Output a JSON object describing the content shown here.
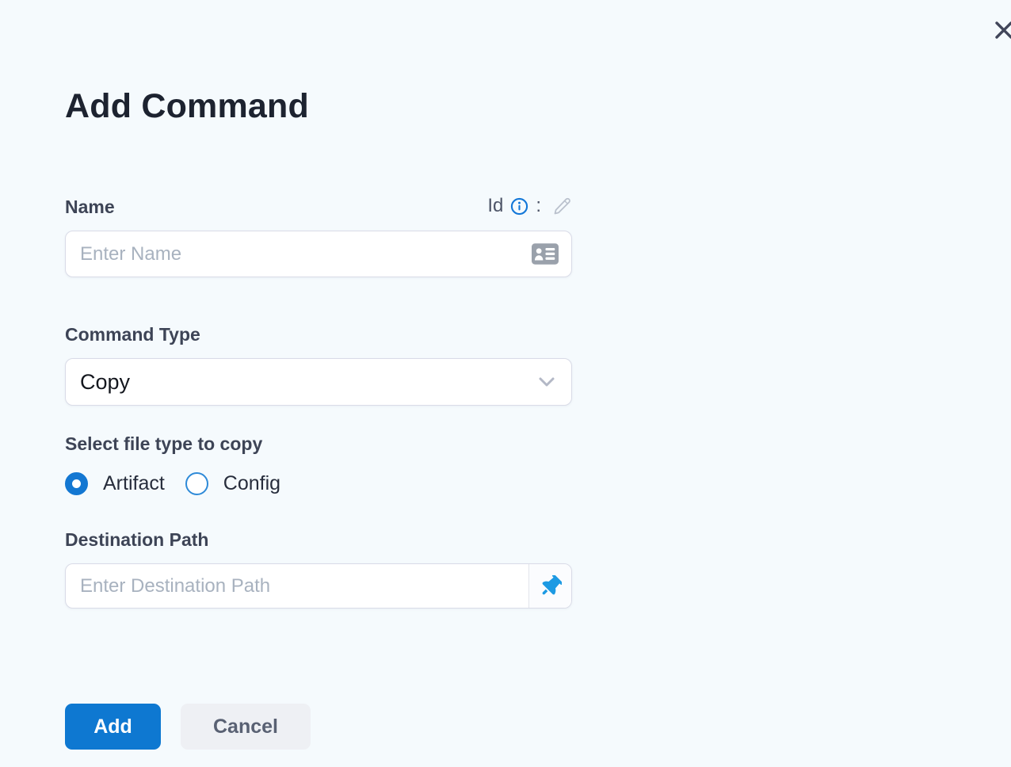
{
  "dialog": {
    "title": "Add Command"
  },
  "name_field": {
    "label": "Name",
    "id_label": "Id",
    "colon": ":",
    "placeholder": "Enter Name"
  },
  "command_type": {
    "label": "Command Type",
    "selected_value": "Copy"
  },
  "file_type": {
    "label": "Select file type to copy",
    "options": [
      {
        "label": "Artifact",
        "selected": true
      },
      {
        "label": "Config",
        "selected": false
      }
    ]
  },
  "destination": {
    "label": "Destination Path",
    "placeholder": "Enter Destination Path"
  },
  "actions": {
    "add_label": "Add",
    "cancel_label": "Cancel"
  },
  "colors": {
    "background": "#f5fafd",
    "primary_blue": "#0e78d1",
    "radio_blue": "#1377d2",
    "pin_blue": "#1d9ae3",
    "info_blue": "#1377d8"
  }
}
